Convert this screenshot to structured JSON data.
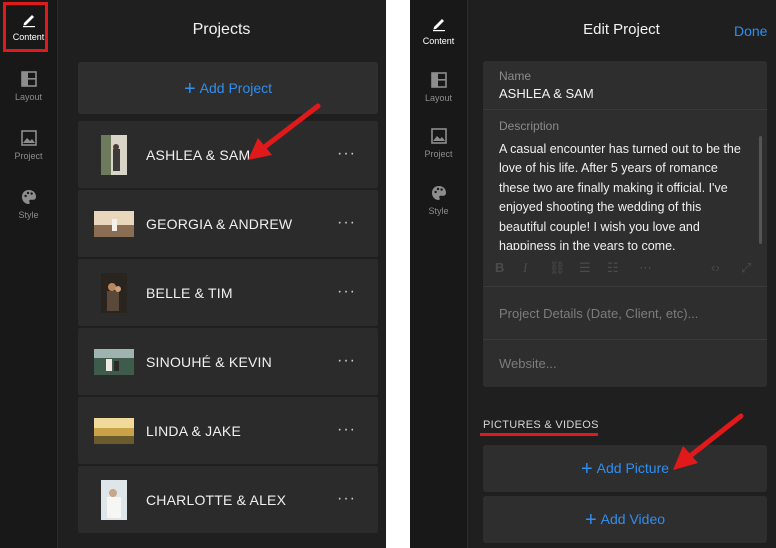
{
  "sidebar": {
    "items": [
      {
        "label": "Content",
        "icon": "pencil-icon"
      },
      {
        "label": "Layout",
        "icon": "layout-icon"
      },
      {
        "label": "Project",
        "icon": "image-icon"
      },
      {
        "label": "Style",
        "icon": "palette-icon"
      }
    ]
  },
  "projects_view": {
    "title": "Projects",
    "add_label": "Add Project",
    "items": [
      {
        "name": "ASHLEA & SAM",
        "more": "···"
      },
      {
        "name": "GEORGIA & ANDREW",
        "more": "···"
      },
      {
        "name": "BELLE & TIM",
        "more": "···"
      },
      {
        "name": "SINOUHÉ & KEVIN",
        "more": "···"
      },
      {
        "name": "LINDA & JAKE",
        "more": "···"
      },
      {
        "name": "CHARLOTTE & ALEX",
        "more": "···"
      }
    ]
  },
  "edit_view": {
    "title": "Edit Project",
    "done_label": "Done",
    "name_label": "Name",
    "name_value": "ASHLEA & SAM",
    "description_label": "Description",
    "description_value": "A casual encounter has turned out to be the love of his life. After 5 years of romance these two are finally making it official. I've enjoyed shooting the wedding of this beautiful couple! I wish you love and happiness in the years to come.",
    "details_placeholder": "Project Details (Date, Client, etc)...",
    "website_placeholder": "Website...",
    "section_label": "PICTURES & VIDEOS",
    "add_picture_label": "Add Picture",
    "add_video_label": "Add Video"
  },
  "colors": {
    "accent": "#2f8ff0",
    "annotation": "#e01a1a",
    "background": "#1f1f1f"
  }
}
